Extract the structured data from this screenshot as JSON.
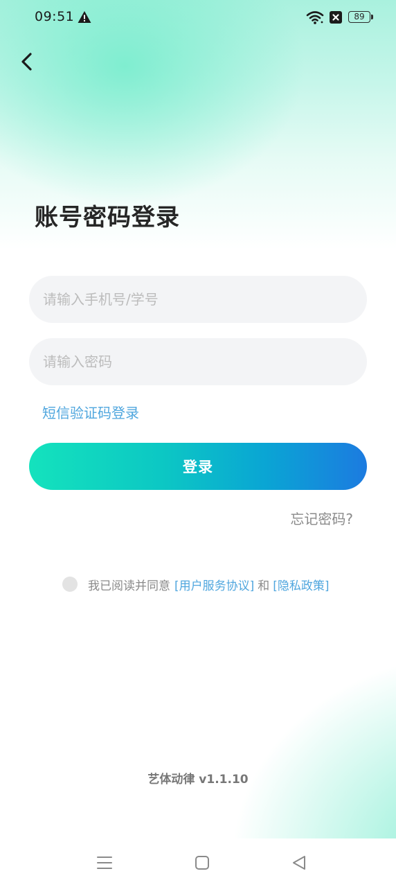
{
  "status_bar": {
    "time": "09:51",
    "battery": "89",
    "icons": [
      "warning-icon",
      "wifi-icon",
      "sim-icon",
      "battery-icon"
    ]
  },
  "header": {
    "back_icon": "chevron-left-icon"
  },
  "title": "账号密码登录",
  "form": {
    "account_placeholder": "请输入手机号/学号",
    "password_placeholder": "请输入密码",
    "sms_login_label": "短信验证码登录",
    "login_label": "登录",
    "forgot_label": "忘记密码?"
  },
  "agreement": {
    "prefix": "我已阅读并同意",
    "terms_label": "[用户服务协议]",
    "conjunction": "和",
    "privacy_label": "[隐私政策]",
    "checked": false
  },
  "footer": {
    "version": "艺体动律 v1.1.10"
  },
  "nav_bar": {
    "icons": [
      "menu-icon",
      "home-icon",
      "back-triangle-icon"
    ]
  },
  "colors": {
    "accent_link": "#4fa6de",
    "button_gradient_start": "#14e2bd",
    "button_gradient_end": "#1c7be0",
    "background_tint": "#a9f1de"
  }
}
